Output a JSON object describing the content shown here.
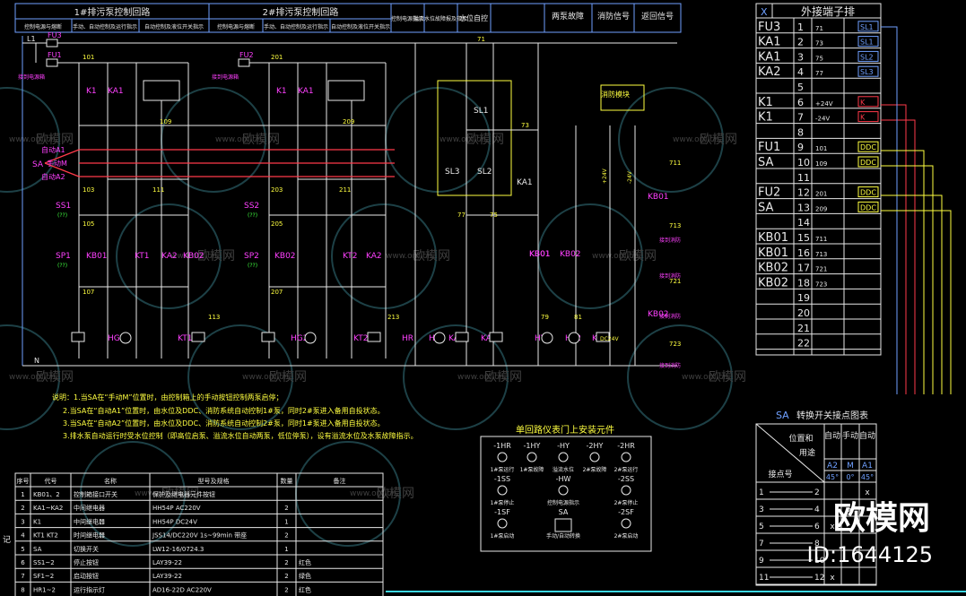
{
  "header": {
    "cells": [
      "1#排污泵控制回路",
      "2#排污泵控制回路",
      "控制电源指示",
      "溢流水位故障报及指示",
      "水位自控",
      "两泵故障",
      "消防信号",
      "返回信号"
    ],
    "sub_cells": [
      "控制电源与熔断",
      "手动、自动控制及运行指示",
      "自动控制及液位开关指示",
      "控制电源与熔断",
      "手动、自动控制及运行指示",
      "自动控制及液位开关指示"
    ]
  },
  "schematic": {
    "fuse_labels": [
      "FU3",
      "FU1",
      "FU2"
    ],
    "line_labels": [
      "L1",
      "N"
    ],
    "wire_numbers": [
      "71",
      "101",
      "109",
      "201",
      "209",
      "103",
      "111",
      "203",
      "211",
      "105",
      "107",
      "205",
      "207",
      "113",
      "213",
      "73",
      "75",
      "77",
      "79",
      "81",
      "711",
      "713",
      "721",
      "723"
    ],
    "mode_labels": [
      "自动A1",
      "手动M",
      "自动A2"
    ],
    "sa_label": "SA",
    "components": [
      "K1",
      "KA1",
      "K1",
      "KA1",
      "SS1",
      "SS2",
      "SP1",
      "KB01",
      "KT1",
      "KA2",
      "KB02",
      "SP2",
      "KB02",
      "KT2",
      "KA2",
      "KB01",
      "KB01",
      "KB02",
      "HG1",
      "KT1",
      "HG2",
      "KT2",
      "HR",
      "HY",
      "KA2",
      "KA1",
      "HY1",
      "HY2",
      "K1",
      "SL1",
      "SL3",
      "SL2",
      "KA1",
      "KB01",
      "KB02"
    ],
    "module_label": "消防模块",
    "voltage_labels": [
      "+24V",
      "-24V",
      "DC24V"
    ],
    "relay_tags": [
      "(??)",
      "(??)",
      "(??)",
      "(??)"
    ],
    "side_notes": [
      "接到电源箱",
      "接到电源箱",
      "接到消防",
      "接到消防",
      "接到消防",
      "接到消防"
    ]
  },
  "watermark": {
    "brand": "欧模网",
    "url": "www.om.cn",
    "corner_brand": "欧模网",
    "corner_id": "ID:1644125"
  },
  "terminal_table": {
    "x_label": "X",
    "title": "外接端子排",
    "rows": [
      {
        "name": "FU3",
        "no": "1",
        "wire": "71",
        "tag": "SL1"
      },
      {
        "name": "KA1",
        "no": "2",
        "wire": "73",
        "tag": "SL1"
      },
      {
        "name": "KA1",
        "no": "3",
        "wire": "75",
        "tag": "SL2"
      },
      {
        "name": "KA2",
        "no": "4",
        "wire": "77",
        "tag": "SL3"
      },
      {
        "name": "",
        "no": "5",
        "wire": "",
        "tag": ""
      },
      {
        "name": "K1",
        "no": "6",
        "wire": "+24V",
        "tag": "K"
      },
      {
        "name": "K1",
        "no": "7",
        "wire": "-24V",
        "tag": "K"
      },
      {
        "name": "",
        "no": "8",
        "wire": "",
        "tag": ""
      },
      {
        "name": "FU1",
        "no": "9",
        "wire": "101",
        "tag": "DDC"
      },
      {
        "name": "SA",
        "no": "10",
        "wire": "109",
        "tag": "DDC"
      },
      {
        "name": "",
        "no": "11",
        "wire": "",
        "tag": ""
      },
      {
        "name": "FU2",
        "no": "12",
        "wire": "201",
        "tag": "DDC"
      },
      {
        "name": "SA",
        "no": "13",
        "wire": "209",
        "tag": "DDC"
      },
      {
        "name": "",
        "no": "14",
        "wire": "",
        "tag": ""
      },
      {
        "name": "KB01",
        "no": "15",
        "wire": "711",
        "tag": ""
      },
      {
        "name": "KB01",
        "no": "16",
        "wire": "713",
        "tag": ""
      },
      {
        "name": "KB02",
        "no": "17",
        "wire": "721",
        "tag": ""
      },
      {
        "name": "KB02",
        "no": "18",
        "wire": "723",
        "tag": ""
      },
      {
        "name": "",
        "no": "19",
        "wire": "",
        "tag": ""
      },
      {
        "name": "",
        "no": "20",
        "wire": "",
        "tag": ""
      },
      {
        "name": "",
        "no": "21",
        "wire": "",
        "tag": ""
      },
      {
        "name": "",
        "no": "22",
        "wire": "",
        "tag": ""
      }
    ]
  },
  "notes": {
    "lines": [
      "说明：1.当SA在“手动M”位置时，由控制箱上的手动按钮控制两泵启停；",
      "2.当SA在“自动A1”位置时，由水位及DDC、消防系统自动控制1#泵，同时2#泵进入备用自投状态。",
      "3.当SA在“自动A2”位置时，由水位及DDC、消防系统自动控制2#泵，同时1#泵进入备用自投状态。",
      "3.排水泵自动运行时受水位控制（即高位启泵、溢流水位自动两泵，低位停泵），设有溢流水位及水泵故障指示。"
    ]
  },
  "panel": {
    "title": "单回路仪表门上安装元件",
    "items": [
      {
        "code": "-1HR",
        "label": "1#泵运行"
      },
      {
        "code": "-1HY",
        "label": "1#泵故障"
      },
      {
        "code": "-HY",
        "label": "溢流水位"
      },
      {
        "code": "-2HY",
        "label": "2#泵故障"
      },
      {
        "code": "-2HR",
        "label": "2#泵运行"
      },
      {
        "code": "-1SS",
        "label": "1#泵停止"
      },
      {
        "code": "-HW",
        "label": "控制电源指示"
      },
      {
        "code": "-2SS",
        "label": "2#泵停止"
      },
      {
        "code": "-1SF",
        "label": "1#泵启动"
      },
      {
        "code": "SA",
        "label": "手动/自动转换"
      },
      {
        "code": "-2SF",
        "label": "2#泵启动"
      }
    ]
  },
  "sa_table": {
    "prefix": "SA",
    "title": "转换开关接点图表",
    "header_pos": "位置和",
    "header_use": "用途",
    "header_no": "接点号",
    "cols": [
      {
        "name": "自动",
        "code": "A2",
        "angle": "45°"
      },
      {
        "name": "手动",
        "code": "M",
        "angle": "0°"
      },
      {
        "name": "自动",
        "code": "A1",
        "angle": "45°"
      }
    ],
    "rows": [
      {
        "contact": "1",
        "end": "2",
        "marks": [
          "",
          "",
          "x"
        ]
      },
      {
        "contact": "3",
        "end": "4",
        "marks": [
          "",
          "x",
          ""
        ]
      },
      {
        "contact": "5",
        "end": "6",
        "marks": [
          "x",
          "",
          ""
        ]
      },
      {
        "contact": "7",
        "end": "8",
        "marks": [
          "",
          "",
          ""
        ]
      },
      {
        "contact": "9",
        "end": "10",
        "marks": [
          "",
          "",
          ""
        ]
      },
      {
        "contact": "11",
        "end": "12",
        "marks": [
          "x",
          "",
          ""
        ]
      }
    ]
  },
  "bom": {
    "headers": [
      "序号",
      "代号",
      "名称",
      "型号及规格",
      "数量",
      "备注"
    ],
    "rows": [
      [
        "1",
        "KB01、2",
        "控制箱接口开关",
        "保护及继电器元件按钮",
        "",
        ""
      ],
      [
        "2",
        "KA1~KA2",
        "中间继电器",
        "HH54P  AC220V",
        "2",
        ""
      ],
      [
        "3",
        "K1",
        "中间继电器",
        "HH54P  DC24V",
        "1",
        ""
      ],
      [
        "4",
        "KT1 KT2",
        "时间继电器",
        "JSS14/DC220V  1s~99min  带座",
        "2",
        ""
      ],
      [
        "5",
        "SA",
        "切换开关",
        "LW12-16/0724.3",
        "1",
        ""
      ],
      [
        "6",
        "SS1~2",
        "停止按钮",
        "LAY39-22",
        "2",
        "红色"
      ],
      [
        "7",
        "SF1~2",
        "启动按钮",
        "LAY39-22",
        "2",
        "绿色"
      ],
      [
        "8",
        "HR1~2",
        "运行指示灯",
        "AD16-22D  AC220V",
        "2",
        "红色"
      ]
    ]
  },
  "left_edge_label": "记"
}
